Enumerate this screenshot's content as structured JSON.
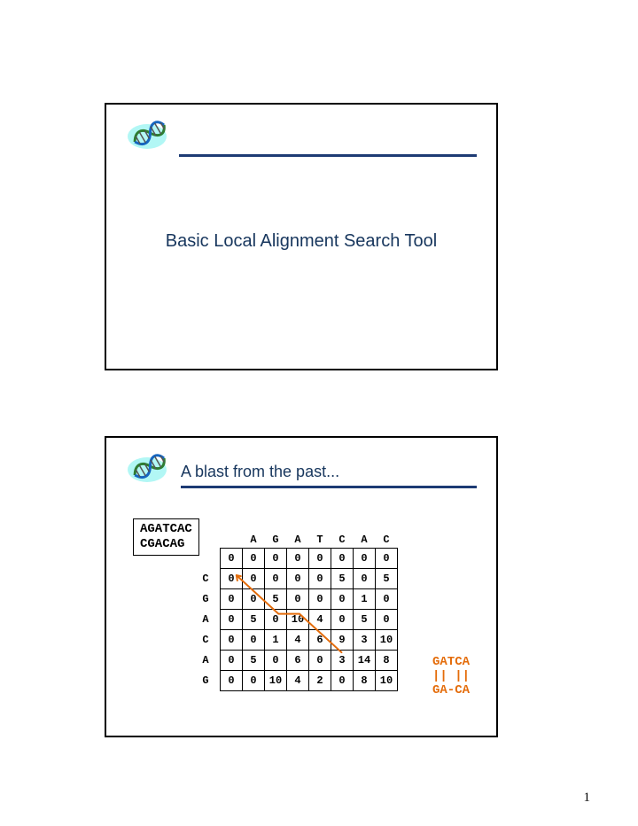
{
  "page_number": "1",
  "slide1": {
    "title": "Basic Local Alignment Search Tool"
  },
  "slide2": {
    "subtitle": "A blast from the past...",
    "seq1": "AGATCAC",
    "seq2": "CGACAG",
    "col_headers": [
      "A",
      "G",
      "A",
      "T",
      "C",
      "A",
      "C"
    ],
    "row_headers": [
      "",
      "C",
      "G",
      "A",
      "C",
      "A",
      "G"
    ],
    "matrix": [
      [
        0,
        0,
        0,
        0,
        0,
        0,
        0,
        0
      ],
      [
        0,
        0,
        0,
        0,
        0,
        5,
        0,
        5
      ],
      [
        0,
        0,
        5,
        0,
        0,
        0,
        1,
        0
      ],
      [
        0,
        5,
        0,
        10,
        4,
        0,
        5,
        0
      ],
      [
        0,
        0,
        1,
        4,
        6,
        9,
        3,
        10
      ],
      [
        0,
        5,
        0,
        6,
        0,
        3,
        14,
        8
      ],
      [
        0,
        0,
        10,
        4,
        2,
        0,
        8,
        10
      ]
    ],
    "alignment": {
      "line1": "GATCA",
      "bars": "|| ||",
      "line2": "GA-CA"
    }
  }
}
